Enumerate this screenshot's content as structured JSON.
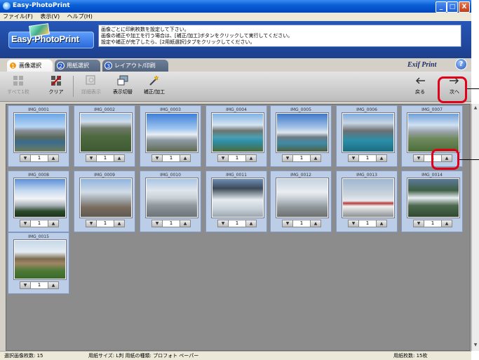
{
  "window": {
    "title": "Easy-PhotoPrint",
    "min": "_",
    "max": "□",
    "close": "X"
  },
  "menu": [
    "ファイル(F)",
    "表示(V)",
    "ヘルプ(H)"
  ],
  "header": {
    "logo": "Easy-PhotoPrint",
    "instructions": [
      "画像ごとに印刷枚数を設定して下さい。",
      "画像の補正や加工を行う場合は、[補正/加工]ボタンをクリックして実行してください。",
      "設定や補正が完了したら、[2用紙選択]タブをクリックしてください。"
    ],
    "exif_print": "Exif Print",
    "help": "?"
  },
  "tabs": [
    {
      "num": "1",
      "label": "画像選択",
      "active": true
    },
    {
      "num": "2",
      "label": "用紙選択",
      "active": false
    },
    {
      "num": "3",
      "label": "レイアウト/印刷",
      "active": false
    }
  ],
  "toolbar": {
    "select_all": "すべて1枚",
    "clear": "クリア",
    "detail": "詳細表示",
    "view_switch": "表示切替",
    "correct": "補正/加工",
    "back": "戻る",
    "next": "次へ"
  },
  "photos": [
    {
      "name": "IMG_0001",
      "count": "1",
      "scene": "mountain-lake"
    },
    {
      "name": "IMG_0002",
      "count": "1",
      "scene": "green-mountain"
    },
    {
      "name": "IMG_0003",
      "count": "1",
      "scene": "tall-peak"
    },
    {
      "name": "IMG_0004",
      "count": "1",
      "scene": "turquoise-lake"
    },
    {
      "name": "IMG_0005",
      "count": "1",
      "scene": "tall-lake"
    },
    {
      "name": "IMG_0006",
      "count": "1",
      "scene": "moraine-lake"
    },
    {
      "name": "IMG_0007",
      "count": "1",
      "scene": "valley"
    },
    {
      "name": "IMG_0008",
      "count": "1",
      "scene": "snow-mountain"
    },
    {
      "name": "IMG_0009",
      "count": "1",
      "scene": "glacier-buildings"
    },
    {
      "name": "IMG_0010",
      "count": "1",
      "scene": "glacier"
    },
    {
      "name": "IMG_0011",
      "count": "1",
      "scene": "ice-tall"
    },
    {
      "name": "IMG_0012",
      "count": "1",
      "scene": "glacier-people"
    },
    {
      "name": "IMG_0013",
      "count": "1",
      "scene": "snowcoach"
    },
    {
      "name": "IMG_0014",
      "count": "1",
      "scene": "waterfall"
    },
    {
      "name": "IMG_0015",
      "count": "1",
      "scene": "house"
    }
  ],
  "status": {
    "selected": "選択画像枚数: 15",
    "paper": "用紙サイズ: L判  用紙の種類: プロフォト ペーパー",
    "sheets": "用紙枚数: 15枚"
  },
  "colors": {
    "highlight": "#e0001a",
    "header": "#1d3f8c",
    "cell": "#bccde8"
  }
}
